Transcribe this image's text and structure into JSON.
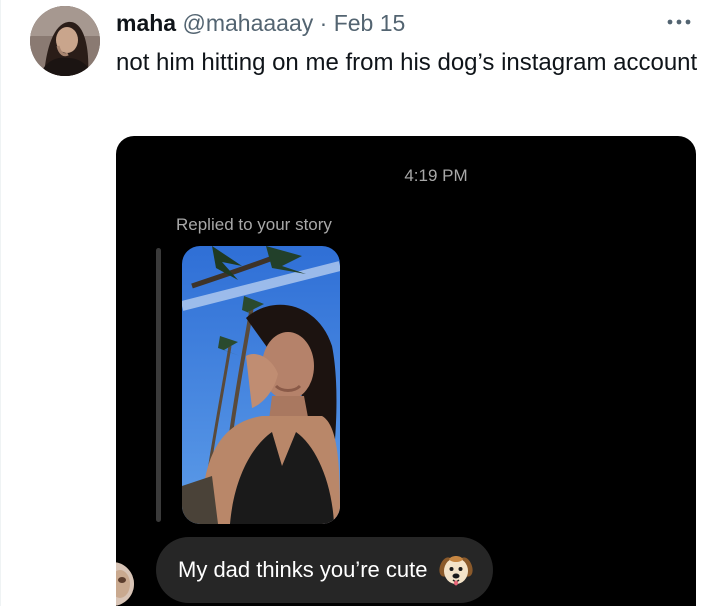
{
  "tweet": {
    "display_name": "maha",
    "handle": "@mahaaaay",
    "separator": "·",
    "date": "Feb 15",
    "text": "not him hitting on me from his dog’s instagram account"
  },
  "dm": {
    "timestamp": "4:19 PM",
    "replied_label": "Replied to your story",
    "message": "My dad thinks you’re cute"
  },
  "icons": {
    "more": "more-horizontal-icon",
    "emoji": "dog-face-icon"
  },
  "colors": {
    "text_primary": "#0f1419",
    "text_secondary": "#536471",
    "dm_background": "#000000",
    "bubble": "#262626",
    "dm_meta": "#a8a8a8"
  }
}
